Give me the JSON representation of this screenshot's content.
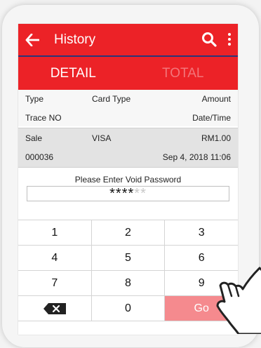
{
  "colors": {
    "brand_red": "#ec2227",
    "accent_navy": "#2a3579",
    "go_key": "#f58a8e",
    "row_gray": "#e3e3e3"
  },
  "appbar": {
    "title": "History",
    "back_icon": "arrow-left",
    "search_icon": "search",
    "menu_icon": "more-vertical"
  },
  "tabs": [
    {
      "label": "DETAIL",
      "active": true
    },
    {
      "label": "TOTAL",
      "active": false
    }
  ],
  "header": {
    "row1": {
      "type": "Type",
      "card_type": "Card Type",
      "amount": "Amount"
    },
    "row2": {
      "trace": "Trace NO",
      "datetime": "Date/Time"
    }
  },
  "transaction": {
    "type": "Sale",
    "card": "VISA",
    "amount": "RM1.00",
    "trace": "000036",
    "datetime": "Sep 4, 2018 11:06"
  },
  "password": {
    "label": "Please Enter Void Password",
    "filled": "****",
    "empty": "**"
  },
  "keypad": {
    "keys": [
      "1",
      "2",
      "3",
      "4",
      "5",
      "6",
      "7",
      "8",
      "9"
    ],
    "zero": "0",
    "go": "Go",
    "delete_icon": "backspace"
  }
}
